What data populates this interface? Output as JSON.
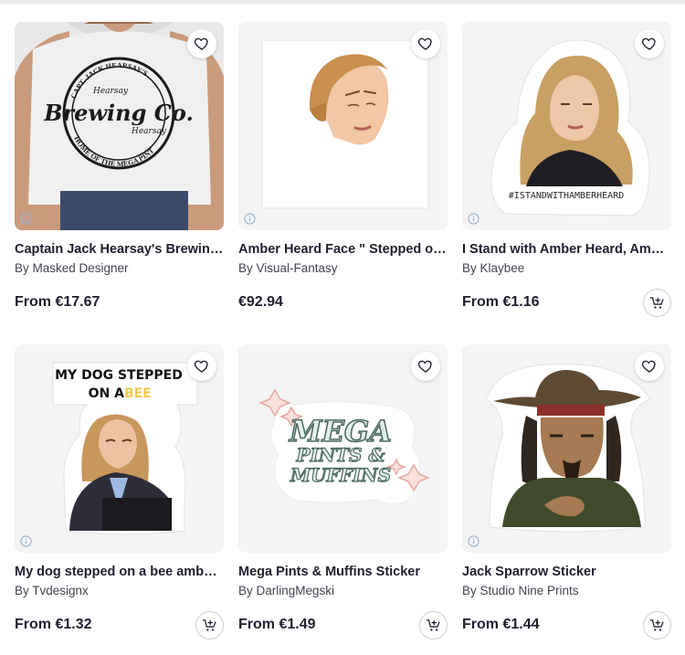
{
  "products": [
    {
      "title": "Captain Jack Hearsay's Brewing Co.",
      "artist": "By Masked Designer",
      "price": "From €17.67",
      "favorite_icon": "heart-outline-icon",
      "cart_icon": "add-to-cart-icon",
      "has_cart": false
    },
    {
      "title": "Amber Heard Face \" Stepped on a Bee \"",
      "artist": "By Visual-Fantasy",
      "price": "€92.94",
      "favorite_icon": "heart-outline-icon",
      "cart_icon": "add-to-cart-icon",
      "has_cart": false
    },
    {
      "title": "I Stand with Amber Heard, Amber Heard Sticker",
      "artist": "By Klaybee",
      "price": "From €1.16",
      "favorite_icon": "heart-outline-icon",
      "cart_icon": "add-to-cart-icon",
      "has_cart": true
    },
    {
      "title": "My dog stepped on a bee amber heard",
      "artist": "By Tvdesignx",
      "price": "From €1.32",
      "favorite_icon": "heart-outline-icon",
      "cart_icon": "add-to-cart-icon",
      "has_cart": true
    },
    {
      "title": "Mega Pints & Muffins Sticker",
      "artist": "By DarlingMegski",
      "price": "From €1.49",
      "favorite_icon": "heart-outline-icon",
      "cart_icon": "add-to-cart-icon",
      "has_cart": true
    },
    {
      "title": "Jack Sparrow Sticker",
      "artist": "By Studio Nine Prints",
      "price": "From €1.44",
      "favorite_icon": "heart-outline-icon",
      "cart_icon": "add-to-cart-icon",
      "has_cart": true
    }
  ],
  "artwork_text": {
    "tshirt": {
      "arc_top": "CAPT. JACK HEARSAY'S",
      "script_1": "Hearsay",
      "script_2": "Hearsay",
      "main": "Brewing Co.",
      "arc_bottom": "HOME OF THE MEGA PINT"
    },
    "sticker_stand": {
      "hashtag": "#ISTANDWITHAMBERHEARD"
    },
    "sticker_dog": {
      "line1": "MY DOG STEPPED",
      "line2_a": "ON A ",
      "line2_b": "BEE"
    },
    "sticker_mega": {
      "line1": "MEGA",
      "line2": "PINTS &",
      "line3": "MUFFINS"
    }
  },
  "colors": {
    "text": "#1f1f2e",
    "muted": "#444452",
    "thumb_bg": "#f4f4f5",
    "bee_yellow": "#f3c94a",
    "mega_green": "#4e6b63",
    "info_blue": "#9db3cf"
  }
}
